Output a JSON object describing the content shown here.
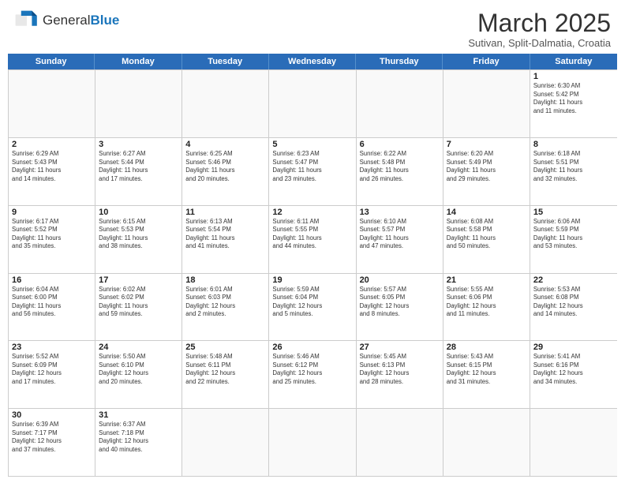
{
  "header": {
    "logo_general": "General",
    "logo_blue": "Blue",
    "month_title": "March 2025",
    "subtitle": "Sutivan, Split-Dalmatia, Croatia"
  },
  "day_headers": [
    "Sunday",
    "Monday",
    "Tuesday",
    "Wednesday",
    "Thursday",
    "Friday",
    "Saturday"
  ],
  "weeks": [
    [
      {
        "day": "",
        "info": "",
        "empty": true
      },
      {
        "day": "",
        "info": "",
        "empty": true
      },
      {
        "day": "",
        "info": "",
        "empty": true
      },
      {
        "day": "",
        "info": "",
        "empty": true
      },
      {
        "day": "",
        "info": "",
        "empty": true
      },
      {
        "day": "",
        "info": "",
        "empty": true
      },
      {
        "day": "1",
        "info": "Sunrise: 6:30 AM\nSunset: 5:42 PM\nDaylight: 11 hours\nand 11 minutes."
      }
    ],
    [
      {
        "day": "2",
        "info": "Sunrise: 6:29 AM\nSunset: 5:43 PM\nDaylight: 11 hours\nand 14 minutes."
      },
      {
        "day": "3",
        "info": "Sunrise: 6:27 AM\nSunset: 5:44 PM\nDaylight: 11 hours\nand 17 minutes."
      },
      {
        "day": "4",
        "info": "Sunrise: 6:25 AM\nSunset: 5:46 PM\nDaylight: 11 hours\nand 20 minutes."
      },
      {
        "day": "5",
        "info": "Sunrise: 6:23 AM\nSunset: 5:47 PM\nDaylight: 11 hours\nand 23 minutes."
      },
      {
        "day": "6",
        "info": "Sunrise: 6:22 AM\nSunset: 5:48 PM\nDaylight: 11 hours\nand 26 minutes."
      },
      {
        "day": "7",
        "info": "Sunrise: 6:20 AM\nSunset: 5:49 PM\nDaylight: 11 hours\nand 29 minutes."
      },
      {
        "day": "8",
        "info": "Sunrise: 6:18 AM\nSunset: 5:51 PM\nDaylight: 11 hours\nand 32 minutes."
      }
    ],
    [
      {
        "day": "9",
        "info": "Sunrise: 6:17 AM\nSunset: 5:52 PM\nDaylight: 11 hours\nand 35 minutes."
      },
      {
        "day": "10",
        "info": "Sunrise: 6:15 AM\nSunset: 5:53 PM\nDaylight: 11 hours\nand 38 minutes."
      },
      {
        "day": "11",
        "info": "Sunrise: 6:13 AM\nSunset: 5:54 PM\nDaylight: 11 hours\nand 41 minutes."
      },
      {
        "day": "12",
        "info": "Sunrise: 6:11 AM\nSunset: 5:55 PM\nDaylight: 11 hours\nand 44 minutes."
      },
      {
        "day": "13",
        "info": "Sunrise: 6:10 AM\nSunset: 5:57 PM\nDaylight: 11 hours\nand 47 minutes."
      },
      {
        "day": "14",
        "info": "Sunrise: 6:08 AM\nSunset: 5:58 PM\nDaylight: 11 hours\nand 50 minutes."
      },
      {
        "day": "15",
        "info": "Sunrise: 6:06 AM\nSunset: 5:59 PM\nDaylight: 11 hours\nand 53 minutes."
      }
    ],
    [
      {
        "day": "16",
        "info": "Sunrise: 6:04 AM\nSunset: 6:00 PM\nDaylight: 11 hours\nand 56 minutes."
      },
      {
        "day": "17",
        "info": "Sunrise: 6:02 AM\nSunset: 6:02 PM\nDaylight: 11 hours\nand 59 minutes."
      },
      {
        "day": "18",
        "info": "Sunrise: 6:01 AM\nSunset: 6:03 PM\nDaylight: 12 hours\nand 2 minutes."
      },
      {
        "day": "19",
        "info": "Sunrise: 5:59 AM\nSunset: 6:04 PM\nDaylight: 12 hours\nand 5 minutes."
      },
      {
        "day": "20",
        "info": "Sunrise: 5:57 AM\nSunset: 6:05 PM\nDaylight: 12 hours\nand 8 minutes."
      },
      {
        "day": "21",
        "info": "Sunrise: 5:55 AM\nSunset: 6:06 PM\nDaylight: 12 hours\nand 11 minutes."
      },
      {
        "day": "22",
        "info": "Sunrise: 5:53 AM\nSunset: 6:08 PM\nDaylight: 12 hours\nand 14 minutes."
      }
    ],
    [
      {
        "day": "23",
        "info": "Sunrise: 5:52 AM\nSunset: 6:09 PM\nDaylight: 12 hours\nand 17 minutes."
      },
      {
        "day": "24",
        "info": "Sunrise: 5:50 AM\nSunset: 6:10 PM\nDaylight: 12 hours\nand 20 minutes."
      },
      {
        "day": "25",
        "info": "Sunrise: 5:48 AM\nSunset: 6:11 PM\nDaylight: 12 hours\nand 22 minutes."
      },
      {
        "day": "26",
        "info": "Sunrise: 5:46 AM\nSunset: 6:12 PM\nDaylight: 12 hours\nand 25 minutes."
      },
      {
        "day": "27",
        "info": "Sunrise: 5:45 AM\nSunset: 6:13 PM\nDaylight: 12 hours\nand 28 minutes."
      },
      {
        "day": "28",
        "info": "Sunrise: 5:43 AM\nSunset: 6:15 PM\nDaylight: 12 hours\nand 31 minutes."
      },
      {
        "day": "29",
        "info": "Sunrise: 5:41 AM\nSunset: 6:16 PM\nDaylight: 12 hours\nand 34 minutes."
      }
    ],
    [
      {
        "day": "30",
        "info": "Sunrise: 6:39 AM\nSunset: 7:17 PM\nDaylight: 12 hours\nand 37 minutes."
      },
      {
        "day": "31",
        "info": "Sunrise: 6:37 AM\nSunset: 7:18 PM\nDaylight: 12 hours\nand 40 minutes."
      },
      {
        "day": "",
        "info": "",
        "empty": true
      },
      {
        "day": "",
        "info": "",
        "empty": true
      },
      {
        "day": "",
        "info": "",
        "empty": true
      },
      {
        "day": "",
        "info": "",
        "empty": true
      },
      {
        "day": "",
        "info": "",
        "empty": true
      }
    ]
  ]
}
